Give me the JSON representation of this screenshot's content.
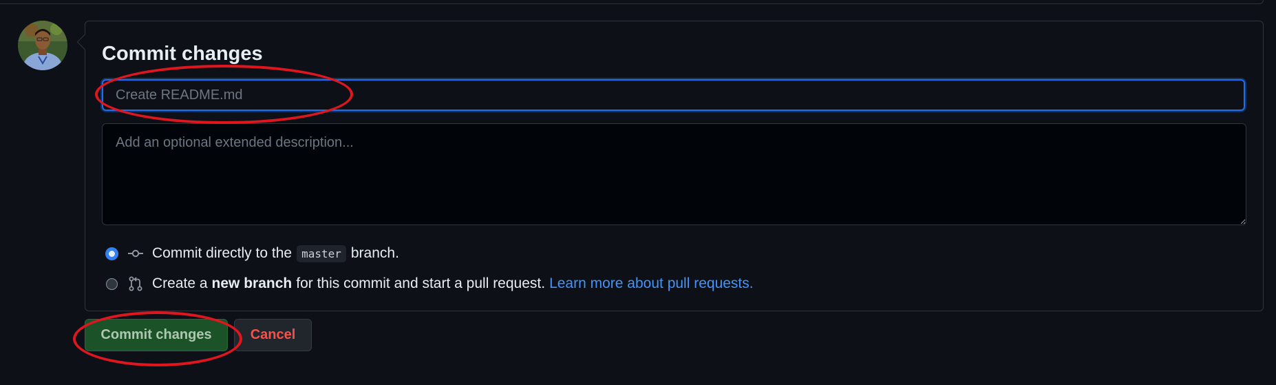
{
  "commit_form": {
    "heading": "Commit changes",
    "summary_placeholder": "Create README.md",
    "summary_value": "",
    "description_placeholder": "Add an optional extended description...",
    "description_value": "",
    "options": [
      {
        "selected": true,
        "icon": "git-commit-icon",
        "text_before": "Commit directly to the",
        "branch_name": "master",
        "text_after": "branch."
      },
      {
        "selected": false,
        "icon": "git-pull-request-icon",
        "text_before": "Create a",
        "bold_text": "new branch",
        "text_after": "for this commit and start a pull request.",
        "link_text": "Learn more about pull requests."
      }
    ]
  },
  "actions": {
    "commit_label": "Commit changes",
    "cancel_label": "Cancel"
  },
  "colors": {
    "background": "#0d1117",
    "accent_blue": "#1f6feb",
    "link_blue": "#4493f8",
    "commit_green": "#1f5e2c",
    "cancel_red": "#f85149",
    "annotation_red": "#e0161f"
  }
}
